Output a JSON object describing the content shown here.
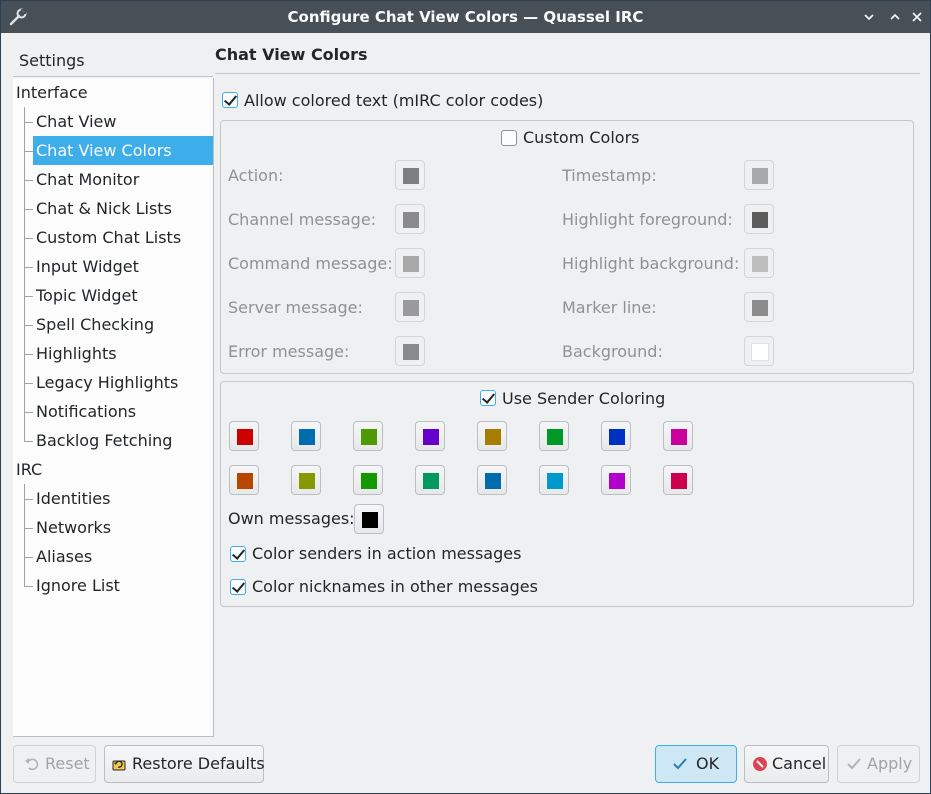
{
  "window": {
    "title": "Configure Chat View Colors — Quassel IRC"
  },
  "icons": {
    "app": "wrench-icon",
    "minimize": "minimize-icon",
    "maximize": "maximize-icon",
    "close": "close-icon"
  },
  "sidebar": {
    "header": "Settings",
    "items": [
      {
        "label": "Interface",
        "level": 0
      },
      {
        "label": "Chat View",
        "level": 1
      },
      {
        "label": "Chat View Colors",
        "level": 1,
        "selected": true
      },
      {
        "label": "Chat Monitor",
        "level": 1
      },
      {
        "label": "Chat & Nick Lists",
        "level": 1
      },
      {
        "label": "Custom Chat Lists",
        "level": 1
      },
      {
        "label": "Input Widget",
        "level": 1
      },
      {
        "label": "Topic Widget",
        "level": 1
      },
      {
        "label": "Spell Checking",
        "level": 1
      },
      {
        "label": "Highlights",
        "level": 1
      },
      {
        "label": "Legacy Highlights",
        "level": 1
      },
      {
        "label": "Notifications",
        "level": 1
      },
      {
        "label": "Backlog Fetching",
        "level": 1
      },
      {
        "label": "IRC",
        "level": 0
      },
      {
        "label": "Identities",
        "level": 1
      },
      {
        "label": "Networks",
        "level": 1
      },
      {
        "label": "Aliases",
        "level": 1
      },
      {
        "label": "Ignore List",
        "level": 1
      }
    ]
  },
  "page": {
    "title": "Chat View Colors",
    "allow_colored_text": {
      "label": "Allow colored text (mIRC color codes)",
      "checked": true
    },
    "custom_colors": {
      "label": "Custom Colors",
      "checked": false,
      "left": [
        {
          "label": "Action:",
          "color": "#7f7f7f"
        },
        {
          "label": "Channel message:",
          "color": "#8a8a8a"
        },
        {
          "label": "Command message:",
          "color": "#a8a8a8"
        },
        {
          "label": "Server message:",
          "color": "#9a9a9a"
        },
        {
          "label": "Error message:",
          "color": "#8a8a8a"
        }
      ],
      "right": [
        {
          "label": "Timestamp:",
          "color": "#a8a8a8"
        },
        {
          "label": "Highlight foreground:",
          "color": "#5c5c5c"
        },
        {
          "label": "Highlight background:",
          "color": "#bdbdbd"
        },
        {
          "label": "Marker line:",
          "color": "#8c8c8c"
        },
        {
          "label": "Background:",
          "color": "#ffffff"
        }
      ]
    },
    "sender_coloring": {
      "label": "Use Sender Coloring",
      "checked": true,
      "row1": [
        "#cc0000",
        "#006cad",
        "#4d9900",
        "#6600cc",
        "#a67d00",
        "#009927",
        "#0030c0",
        "#cc009a"
      ],
      "row2": [
        "#b94600",
        "#869900",
        "#149900",
        "#009960",
        "#006cad",
        "#0099cc",
        "#b300cc",
        "#cc004d"
      ],
      "own_messages": {
        "label": "Own messages:",
        "color": "#000000"
      },
      "color_senders_action": {
        "label": "Color senders in action messages",
        "checked": true
      },
      "color_nicknames_other": {
        "label": "Color nicknames in other messages",
        "checked": true
      }
    }
  },
  "buttons": {
    "reset": {
      "label": "Reset",
      "icon": "undo-icon"
    },
    "restore_defaults": {
      "label": "Restore Defaults",
      "icon": "restore-icon"
    },
    "ok": {
      "label": "OK",
      "icon": "checkmark-icon"
    },
    "cancel": {
      "label": "Cancel",
      "icon": "cancel-icon"
    },
    "apply": {
      "label": "Apply",
      "icon": "checkmark-icon"
    }
  }
}
